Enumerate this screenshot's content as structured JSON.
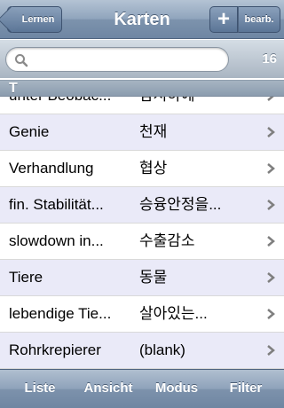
{
  "navbar": {
    "back_label": "Lernen",
    "title": "Karten",
    "add_label": "+",
    "edit_label": "bearb."
  },
  "search": {
    "value": "",
    "placeholder": "",
    "count": "16"
  },
  "section": {
    "header": "T"
  },
  "rows": [
    {
      "front": "unter Beobac...",
      "back": "감시하에"
    },
    {
      "front": "Genie",
      "back": "천재"
    },
    {
      "front": "Verhandlung",
      "back": "협상"
    },
    {
      "front": "fin. Stabilität...",
      "back": "승융안정을..."
    },
    {
      "front": "slowdown in...",
      "back": "수출감소"
    },
    {
      "front": "Tiere",
      "back": "동물"
    },
    {
      "front": "lebendige Tie...",
      "back": "살아있는..."
    },
    {
      "front": "Rohrkrepierer",
      "back": "(blank)"
    }
  ],
  "toolbar": {
    "list_label": "Liste",
    "view_label": "Ansicht",
    "mode_label": "Modus",
    "filter_label": "Filter"
  },
  "colors": {
    "accent": "#6e86a3",
    "row_alt": "#eaeaf8"
  }
}
